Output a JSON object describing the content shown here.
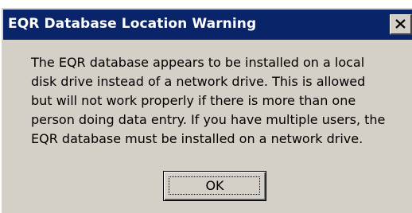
{
  "dialog": {
    "title": "EQR Database Location Warning",
    "close_icon": "close-x-icon",
    "message_lines": [
      "The EQR database appears to be installed on a local",
      "disk drive instead of a network drive. This is allowed",
      "but will not work properly if there is more than one",
      "person doing data entry. If you have multiple users, the",
      "EQR database must be installed on a network drive."
    ],
    "ok_label": "OK"
  },
  "colors": {
    "titlebar": "#0a246a",
    "face": "#d4d0c8",
    "title_text": "#ffffff"
  }
}
